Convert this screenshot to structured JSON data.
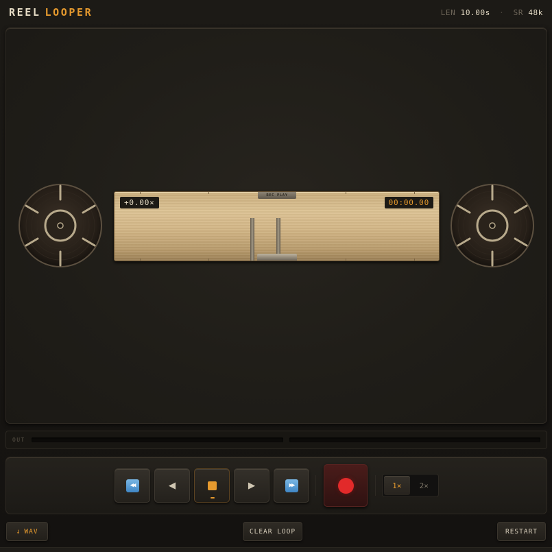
{
  "header": {
    "brand_word1": "REEL",
    "brand_word2": "LOOPER",
    "len_label": "LEN",
    "len_value": "10.00s",
    "sr_label": "SR",
    "sr_value": "48k",
    "separator": "·"
  },
  "deck": {
    "speed_readout": "+0.00×",
    "time_readout": "00:00.00",
    "head_label": "REC PLAY"
  },
  "meter": {
    "label": "OUT",
    "left_level": 0,
    "right_level": 0
  },
  "transport": {
    "rewind_icon": "rewind-icon",
    "back_icon": "play-reverse-icon",
    "stop_icon": "stop-icon",
    "play_icon": "play-icon",
    "forward_icon": "fast-forward-icon",
    "record_icon": "record-icon",
    "speed_options": [
      "1×",
      "2×"
    ],
    "speed_selected": "1×"
  },
  "actions": {
    "wav_label": "WAV",
    "clear_label": "CLEAR LOOP",
    "restart_label": "RESTART"
  },
  "colors": {
    "accent": "#e69a2e",
    "record": "#e22a2a",
    "tape": "#d2b585"
  }
}
